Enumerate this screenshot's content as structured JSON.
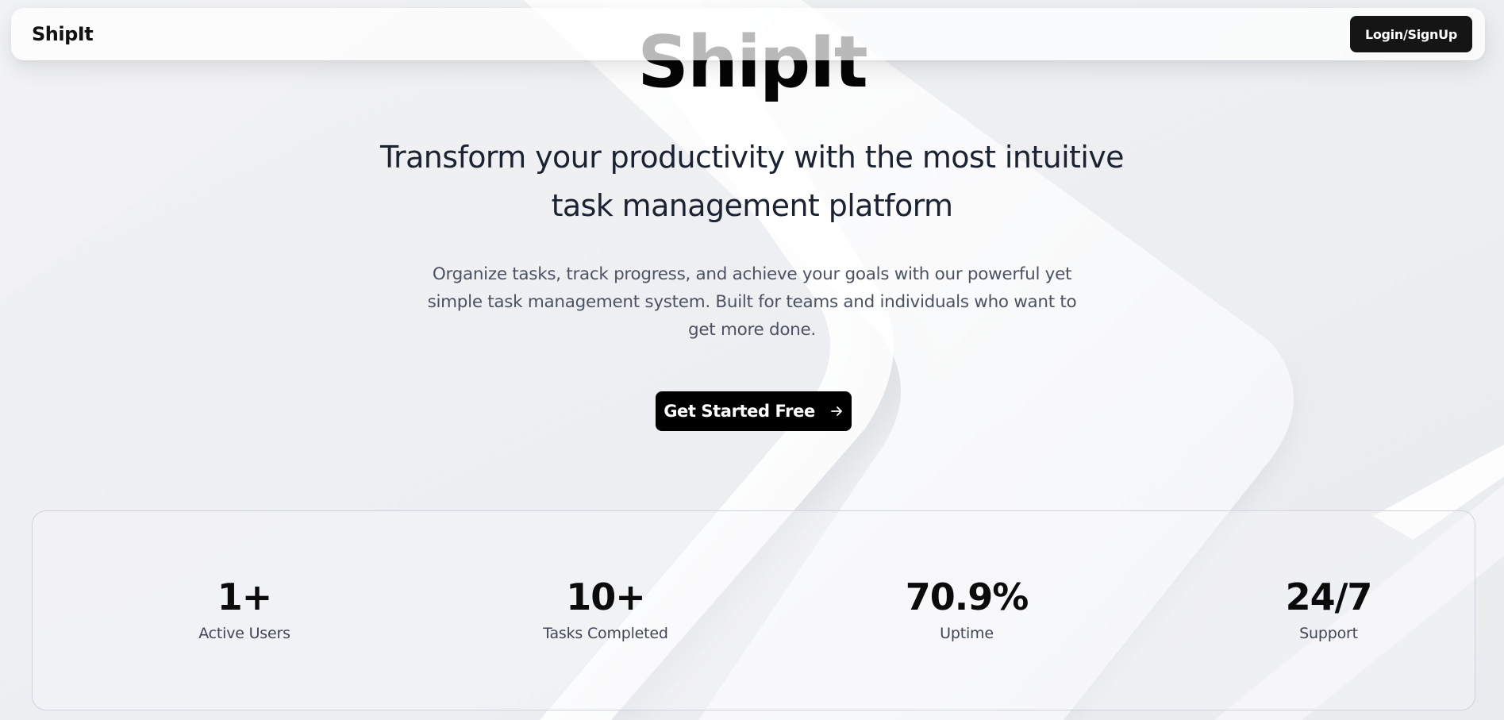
{
  "navbar": {
    "brand": "ShipIt",
    "login_label": "Login/SignUp"
  },
  "hero": {
    "title": "ShipIt",
    "subtitle": "Transform your productivity with the most intuitive task management platform",
    "description": "Organize tasks, track progress, and achieve your goals with our powerful yet simple task management system. Built for teams and individuals who want to get more done.",
    "cta_label": "Get Started Free",
    "cta_icon": "arrow-right-icon"
  },
  "stats": [
    {
      "value": "1+",
      "label": "Active Users"
    },
    {
      "value": "10+",
      "label": "Tasks Completed"
    },
    {
      "value": "70.9%",
      "label": "Uptime"
    },
    {
      "value": "24/7",
      "label": "Support"
    }
  ],
  "colors": {
    "background": "#eef0f3",
    "primary_button": "#000000",
    "text_primary": "#111111",
    "text_muted": "#4b5363"
  }
}
